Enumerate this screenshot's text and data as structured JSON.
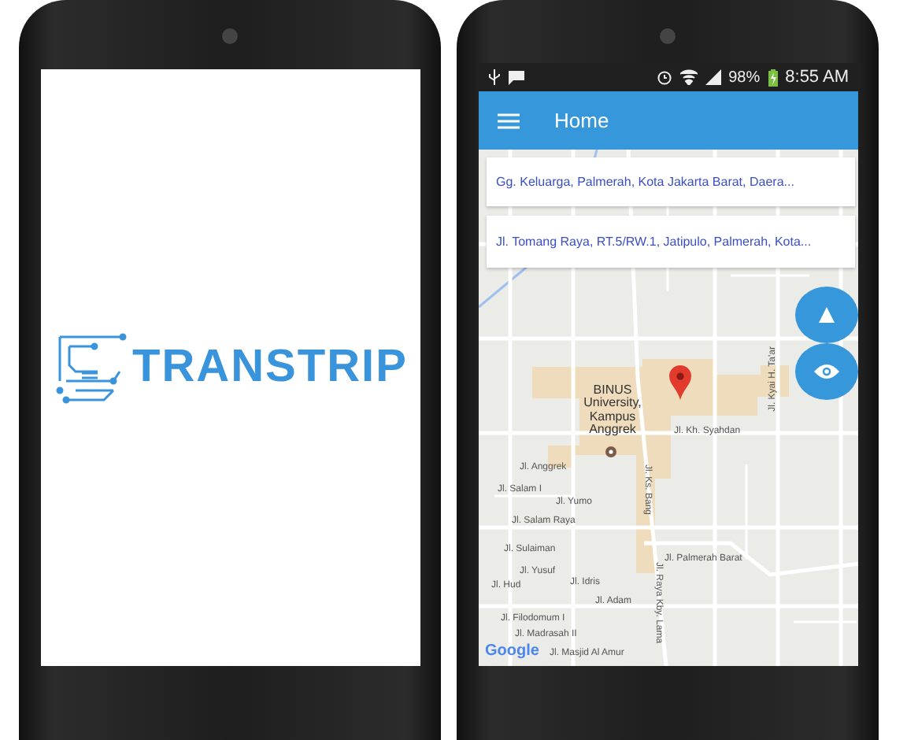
{
  "splash": {
    "logo_text": "TRANSTRIP"
  },
  "status_bar": {
    "battery": "98%",
    "time": "8:55 AM"
  },
  "app_bar": {
    "title": "Home"
  },
  "address_fields": [
    {
      "value": "Gg. Keluarga, Palmerah, Kota Jakarta Barat, Daera..."
    },
    {
      "value": "Jl. Tomang Raya, RT.5/RW.1, Jatipulo, Palmerah, Kota..."
    }
  ],
  "map": {
    "place": "BINUS University, Kampus Anggrek",
    "labels": [
      {
        "text": "Jl. Kh. Syahdan",
        "kind": "flat"
      },
      {
        "text": "Jl. Anggrek",
        "kind": "flat"
      },
      {
        "text": "Jl. Salam I",
        "kind": "flat"
      },
      {
        "text": "Jl. Yumo",
        "kind": "flat"
      },
      {
        "text": "Jl. Salam Raya",
        "kind": "flat"
      },
      {
        "text": "Jl. Sulaiman",
        "kind": "flat"
      },
      {
        "text": "Jl. Yusuf",
        "kind": "flat"
      },
      {
        "text": "Jl. Hud",
        "kind": "flat"
      },
      {
        "text": "Jl. Idris",
        "kind": "flat"
      },
      {
        "text": "Jl. Adam",
        "kind": "flat"
      },
      {
        "text": "Jl. Palmerah Barat",
        "kind": "flat"
      },
      {
        "text": "Jl. Filodomum I",
        "kind": "flat"
      },
      {
        "text": "Jl. Madrasah II",
        "kind": "flat"
      },
      {
        "text": "Jl. Masjid Al Amur",
        "kind": "flat"
      },
      {
        "text": "Jl. Ks. Bang",
        "kind": "down"
      },
      {
        "text": "Jl. Raya Kby. Lama",
        "kind": "down"
      },
      {
        "text": "Jl. Kyai H. Ta'ar",
        "kind": "up"
      }
    ],
    "attribution": "Google"
  }
}
